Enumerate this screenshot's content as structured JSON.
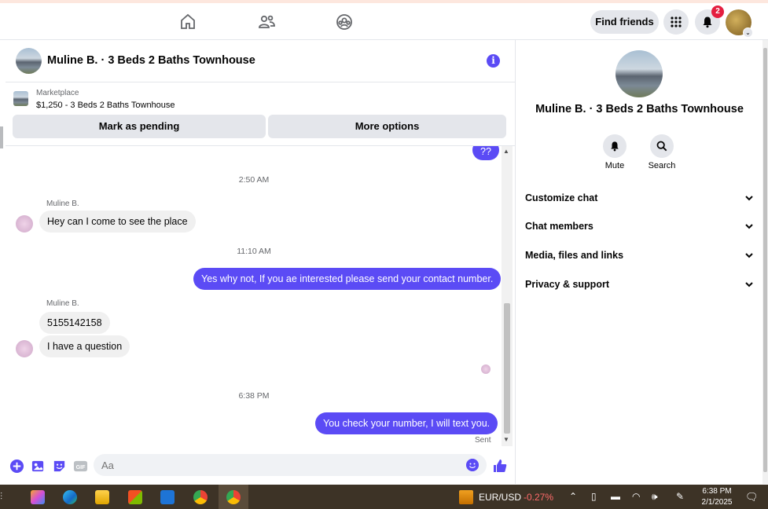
{
  "topnav": {
    "find_friends": "Find friends",
    "notification_count": "2"
  },
  "chat": {
    "title": "Muline B. · 3 Beds 2 Baths Townhouse",
    "marketplace_label": "Marketplace",
    "listing": "$1,250 - 3 Beds 2 Baths Townhouse",
    "mark_pending": "Mark as pending",
    "more_options": "More options"
  },
  "messages": {
    "partial_out": "??",
    "time1": "2:50 AM",
    "sender1": "Muline B.",
    "msg1": "Hey can I come to see the place",
    "time2": "11:10 AM",
    "msg2": "Yes why not, If you ae interested please send your contact number.",
    "sender2": "Muline B.",
    "msg3": "5155142158",
    "msg4": "I have a question",
    "time3": "6:38 PM",
    "msg5": "You check your number, I will text you.",
    "sent": "Sent"
  },
  "composer": {
    "placeholder": "Aa"
  },
  "right_panel": {
    "title": "Muline B. · 3 Beds 2 Baths Townhouse",
    "mute": "Mute",
    "search": "Search",
    "rows": [
      "Customize chat",
      "Chat members",
      "Media, files and links",
      "Privacy & support"
    ]
  },
  "taskbar": {
    "ticker": "EUR/USD",
    "change": "-0.27%",
    "time": "6:38 PM",
    "date": "2/1/2025"
  },
  "colors": {
    "accent": "#5b4bf5",
    "bubble_in": "#f0f0f0",
    "taskbar": "#3d3326",
    "notification": "#e41e3f"
  }
}
